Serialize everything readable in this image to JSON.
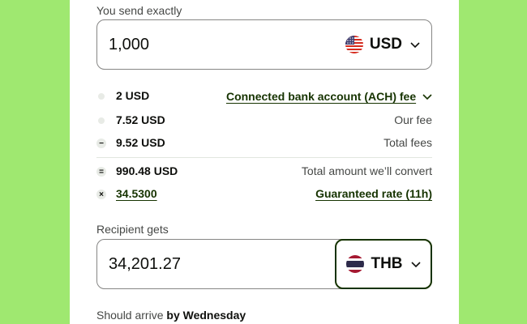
{
  "send": {
    "label": "You send exactly",
    "amount": "1,000",
    "currency": "USD"
  },
  "fees": [
    {
      "value": "2 USD",
      "desc": "Connected bank account (ACH) fee",
      "bullet": ""
    },
    {
      "value": "7.52 USD",
      "desc": "Our fee",
      "bullet": ""
    },
    {
      "value": "9.52 USD",
      "desc": "Total fees",
      "bullet": "−"
    },
    {
      "value": "990.48 USD",
      "desc": "Total amount we’ll convert",
      "bullet": "="
    },
    {
      "value": "34.5300",
      "desc": "Guaranteed rate (11h)",
      "bullet": "×"
    }
  ],
  "receive": {
    "label": "Recipient gets",
    "amount": "34,201.27",
    "currency": "THB"
  },
  "arrival": {
    "prefix": "Should arrive",
    "day": "by Wednesday"
  },
  "icons": {
    "send_flag": "us-flag-icon",
    "receive_flag": "thailand-flag-icon",
    "chevron": "chevron-down-icon"
  },
  "colors": {
    "background": "#9fe870",
    "accent": "#163300"
  }
}
